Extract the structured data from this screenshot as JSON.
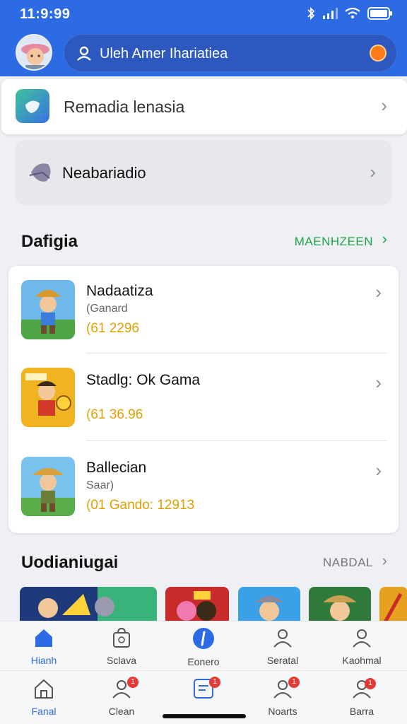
{
  "status": {
    "time": "11:9:99"
  },
  "search": {
    "placeholder": "Uleh Amer Ihariatiea"
  },
  "top_card": {
    "label": "Remadia  lenasia"
  },
  "second_card": {
    "label": "Neabariadio"
  },
  "section1": {
    "title": "Dafigia",
    "link": "MAENHZEEN"
  },
  "games": [
    {
      "name": "Nadaatiza",
      "sub": "(Ganard",
      "price": "(61 2296"
    },
    {
      "name": "Stadlg: Ok Gama",
      "sub": "",
      "price": "(61 36.96"
    },
    {
      "name": "Ballecian",
      "sub": "Saar)",
      "price": "(01 Gando: 12913"
    }
  ],
  "section2": {
    "title": "Uodianiugai",
    "link": "NABDAL"
  },
  "tabbar_top": [
    {
      "label": "Hianh"
    },
    {
      "label": "Sclava"
    },
    {
      "label": "Eonero"
    },
    {
      "label": "Seratal"
    },
    {
      "label": "Kaohmal"
    }
  ],
  "tabbar_bottom": [
    {
      "label": "Fanal"
    },
    {
      "label": "Clean",
      "badge": "1"
    },
    {
      "label": "",
      "badge": "1"
    },
    {
      "label": "Noarts",
      "badge": "1"
    },
    {
      "label": "Barra",
      "badge": "1"
    }
  ],
  "colors": {
    "brand": "#2d6be4",
    "accent_green": "#1fa34a",
    "price": "#e0a000"
  }
}
